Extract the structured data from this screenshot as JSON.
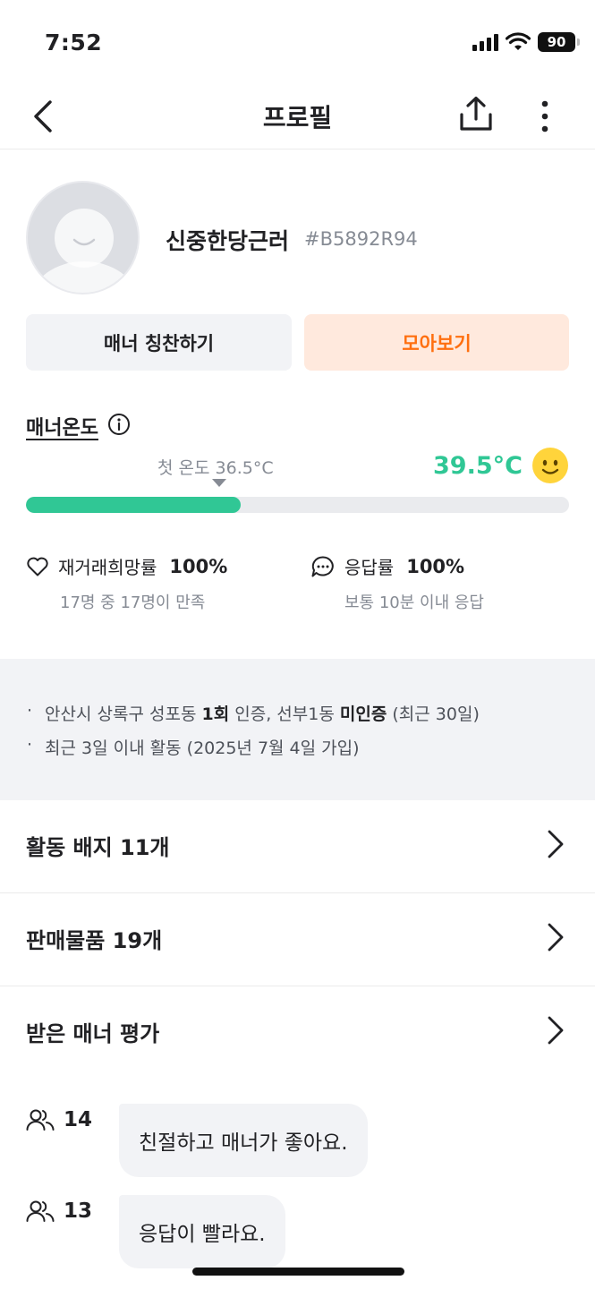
{
  "status_bar": {
    "time": "7:52",
    "battery": "90"
  },
  "nav": {
    "title": "프로필"
  },
  "profile": {
    "nickname": "신중한당근러",
    "user_id": "#B5892R94"
  },
  "buttons": {
    "praise": "매너 칭찬하기",
    "collect": "모아보기"
  },
  "manner": {
    "label": "매너온도",
    "first_temperature": "첫 온도 36.5°C",
    "temperature": "39.5°C",
    "temperature_fill_fraction": 0.395,
    "accent_color": "#30c795"
  },
  "stats": {
    "repurchase": {
      "label": "재거래희망률",
      "value": "100%",
      "sub": "17명 중 17명이 만족"
    },
    "response": {
      "label": "응답률",
      "value": "100%",
      "sub": "보통 10분 이내 응답"
    }
  },
  "info": {
    "verify_prefix": "안산시 상록구 성포동",
    "verify_count": "1회",
    "verify_middle": "인증, 선부1동",
    "verify_status": "미인증",
    "verify_suffix": "(최근 30일)",
    "activity": "최근 3일 이내 활동 (2025년 7월 4일 가입)"
  },
  "menu": {
    "badges": "활동 배지 11개",
    "sales": "판매물품 19개",
    "manner_reviews": "받은 매너 평가"
  },
  "reviews": [
    {
      "count": "14",
      "text": "친절하고 매너가 좋아요."
    },
    {
      "count": "13",
      "text": "응답이 빨라요."
    }
  ],
  "colors": {
    "brand_orange": "#ff6f0f",
    "secondary_text": "#868b94"
  }
}
